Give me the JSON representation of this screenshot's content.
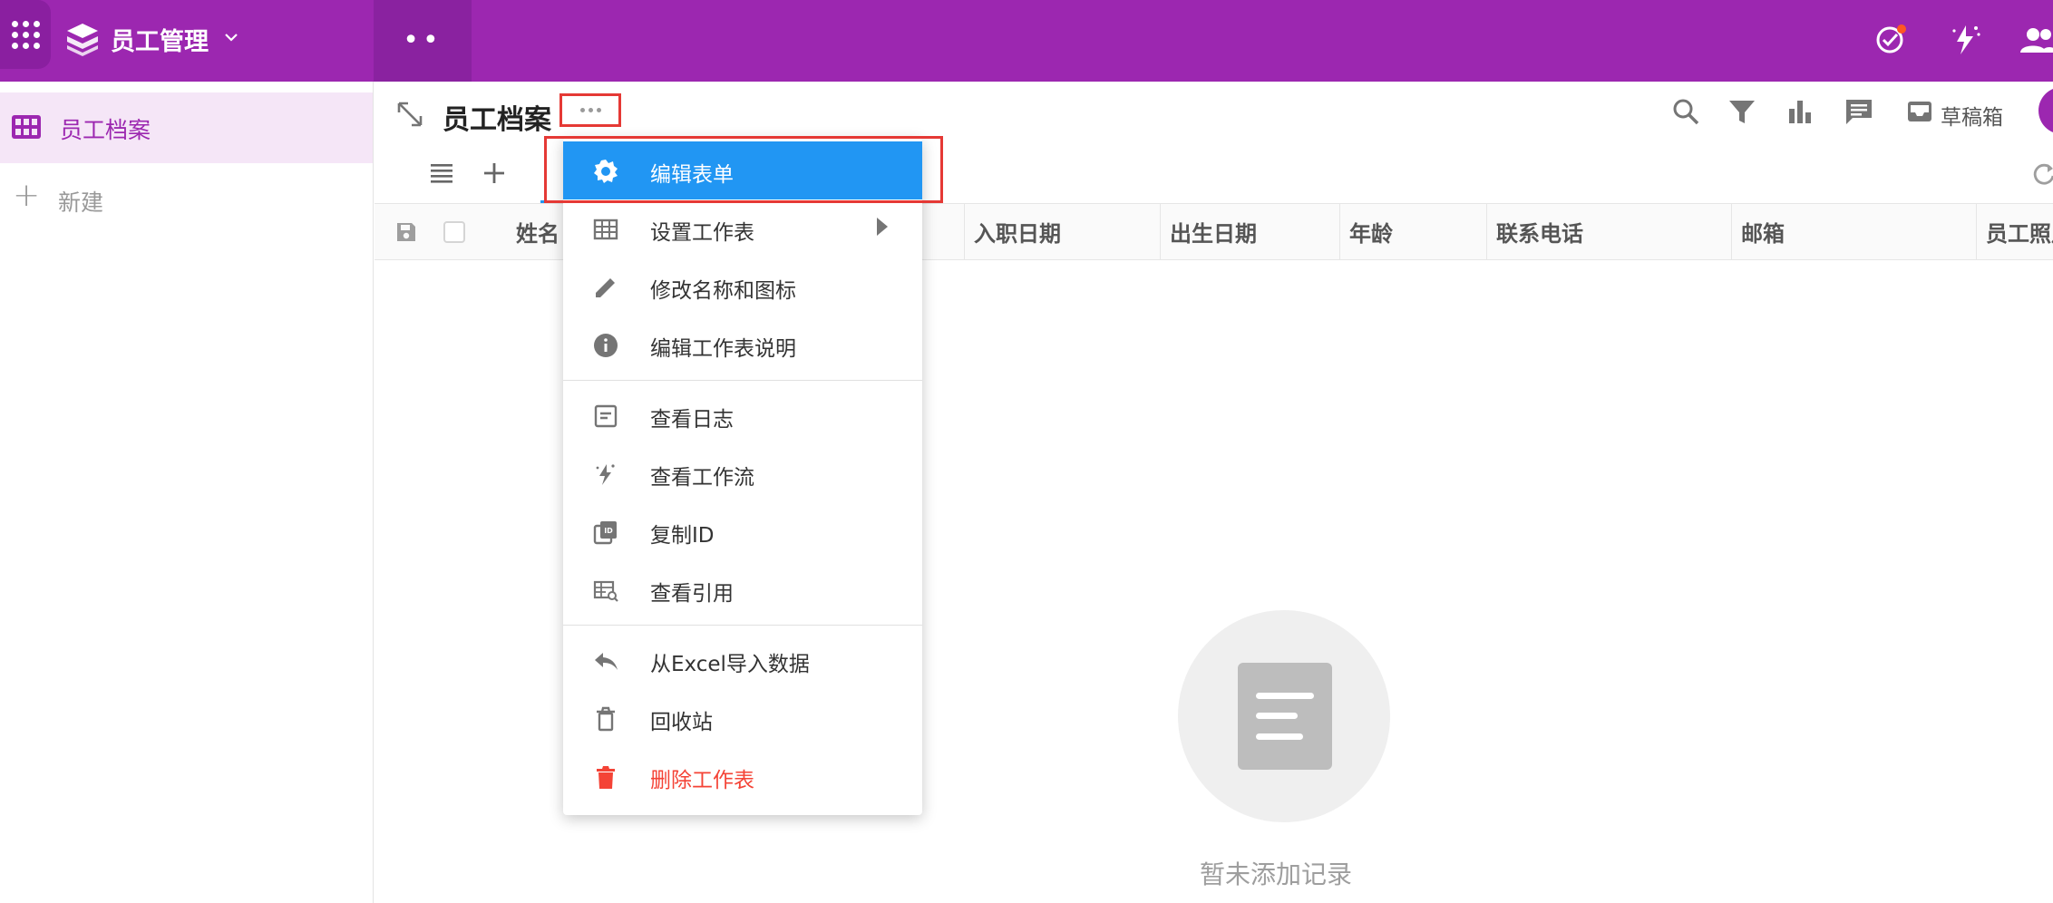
{
  "topbar": {
    "app_title": "员工管理",
    "colors": {
      "bar": "#9c27b0",
      "notify_dot": "#ff5722"
    }
  },
  "sidebar": {
    "items": [
      {
        "label": "员工档案",
        "icon": "grid-table-icon",
        "active": true
      },
      {
        "label": "新建",
        "icon": "plus-icon",
        "active": false
      }
    ]
  },
  "header": {
    "sheet_title": "员工档案",
    "drafts_label": "草稿箱"
  },
  "table": {
    "columns": [
      "姓名",
      "入职日期",
      "出生日期",
      "年龄",
      "联系电话",
      "邮箱",
      "员工照片"
    ]
  },
  "menu": {
    "items": [
      {
        "label": "编辑表单",
        "icon": "gear-icon",
        "state": "highlighted"
      },
      {
        "label": "设置工作表",
        "icon": "table-icon",
        "has_submenu": true
      },
      {
        "label": "修改名称和图标",
        "icon": "pencil-icon"
      },
      {
        "label": "编辑工作表说明",
        "icon": "info-icon"
      },
      {
        "label": "查看日志",
        "icon": "log-icon"
      },
      {
        "label": "查看工作流",
        "icon": "workflow-icon"
      },
      {
        "label": "复制ID",
        "icon": "copy-id-icon"
      },
      {
        "label": "查看引用",
        "icon": "reference-icon"
      },
      {
        "label": "从Excel导入数据",
        "icon": "reply-icon"
      },
      {
        "label": "回收站",
        "icon": "recycle-bin-icon"
      },
      {
        "label": "删除工作表",
        "icon": "trash-icon",
        "danger": true
      }
    ]
  },
  "empty_state": {
    "text": "暂未添加记录"
  }
}
